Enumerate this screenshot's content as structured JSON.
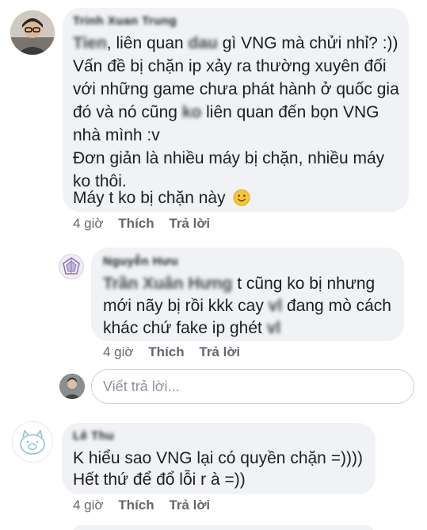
{
  "comments": [
    {
      "author_name": "Trinh Xuan Trung",
      "lines": [
        {
          "pre_blur": "Tien",
          "text": ", liên quan ",
          "mid_blur": "dau",
          "text2": " gì VNG mà chửi nhỉ? :))"
        },
        {
          "text": "Vấn đề bị chặn ip xảy ra thường xuyên đối"
        },
        {
          "text": "với những game chưa phát hành ở quốc gia"
        },
        {
          "text": "đó và nó cũng ",
          "mid_blur": "ko",
          "text2": " liên quan đến bọn VNG"
        },
        {
          "text": "nhà mình :v"
        },
        {
          "text": "Đơn giản là nhiều máy bị chặn, nhiều máy"
        },
        {
          "text": "ko thôi."
        },
        {
          "text": "Máy t ko bị chặn này",
          "emoji": "slightly-smiling-face-icon"
        }
      ],
      "time": "4 giờ",
      "like_label": "Thích",
      "reply_label": "Trả lời"
    },
    {
      "author_name": "Nguyễn Hưu",
      "lines": [
        {
          "pre_blur": "Trần Xuân Hưng",
          "text": " t cũng ko bị nhưng"
        },
        {
          "text": "mới nãy bị rồi kkk cay ",
          "mid_blur": "vl",
          "text2": " đang mò cách"
        },
        {
          "text": "khác chứ fake ip ghét ",
          "mid_blur": "vl"
        }
      ],
      "time": "4 giờ",
      "like_label": "Thích",
      "reply_label": "Trả lời"
    },
    {
      "author_name": "Lê Thu",
      "lines": [
        {
          "text": "K hiểu sao VNG lại có quyền chặn =))))"
        },
        {
          "text": "Hết thứ để đổ lỗi r à =))"
        }
      ],
      "time": "4 giờ",
      "like_label": "Thích",
      "reply_label": "Trả lời"
    }
  ],
  "reply_input": {
    "placeholder": "Viết trả lời..."
  },
  "colors": {
    "bubble": "#f0f2f5",
    "meta_text": "#65676b",
    "body_text": "#1c1e21",
    "emoji": "#f7c33a"
  }
}
